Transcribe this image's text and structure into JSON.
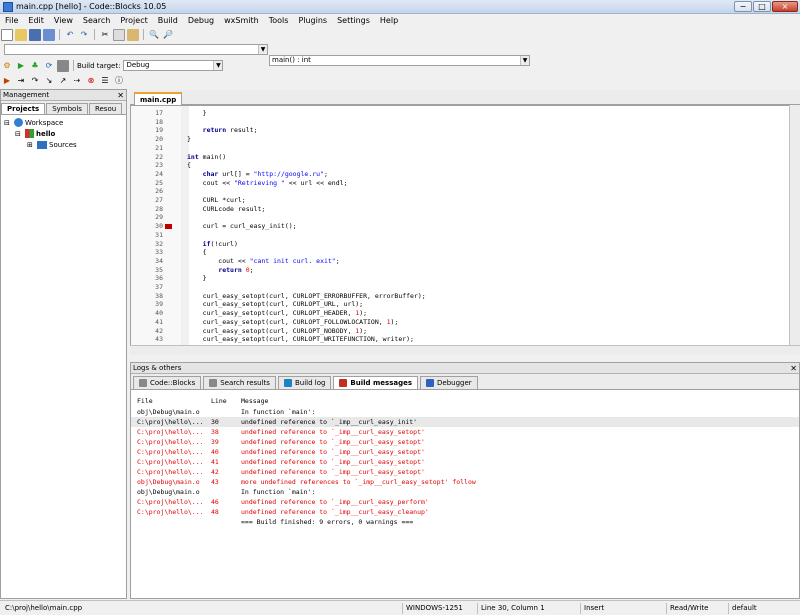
{
  "window": {
    "title": "main.cpp [hello] - Code::Blocks 10.05",
    "min": "−",
    "max": "□",
    "close": "×"
  },
  "menu": [
    "File",
    "Edit",
    "View",
    "Search",
    "Project",
    "Build",
    "Debug",
    "wxSmith",
    "Tools",
    "Plugins",
    "Settings",
    "Help"
  ],
  "toolbar": {
    "function_combo": "main() : int",
    "build_target_label": "Build target:",
    "build_target_value": "Debug"
  },
  "management": {
    "title": "Management",
    "tabs": [
      "Projects",
      "Symbols",
      "Resou"
    ],
    "tree": {
      "workspace": "Workspace",
      "project": "hello",
      "folder": "Sources"
    }
  },
  "editor": {
    "tab": "main.cpp",
    "lines": [
      {
        "n": "17",
        "t": "    }"
      },
      {
        "n": "18",
        "t": ""
      },
      {
        "n": "19",
        "t": "    return result;"
      },
      {
        "n": "20",
        "t": "}"
      },
      {
        "n": "21",
        "t": ""
      },
      {
        "n": "22",
        "t": "int main()"
      },
      {
        "n": "23",
        "t": "{"
      },
      {
        "n": "24",
        "t": "    char url[] = \"http://google.ru\";"
      },
      {
        "n": "25",
        "t": "    cout << \"Retrieving \" << url << endl;"
      },
      {
        "n": "26",
        "t": ""
      },
      {
        "n": "27",
        "t": "    CURL *curl;"
      },
      {
        "n": "28",
        "t": "    CURLcode result;"
      },
      {
        "n": "29",
        "t": ""
      },
      {
        "n": "30",
        "t": "    curl = curl_easy_init();"
      },
      {
        "n": "31",
        "t": ""
      },
      {
        "n": "32",
        "t": "    if(!curl)"
      },
      {
        "n": "33",
        "t": "    {"
      },
      {
        "n": "34",
        "t": "        cout << \"cant init curl. exit\";"
      },
      {
        "n": "35",
        "t": "        return 0;"
      },
      {
        "n": "36",
        "t": "    }"
      },
      {
        "n": "37",
        "t": ""
      },
      {
        "n": "38",
        "t": "    curl_easy_setopt(curl, CURLOPT_ERRORBUFFER, errorBuffer);"
      },
      {
        "n": "39",
        "t": "    curl_easy_setopt(curl, CURLOPT_URL, url);"
      },
      {
        "n": "40",
        "t": "    curl_easy_setopt(curl, CURLOPT_HEADER, 1);"
      },
      {
        "n": "41",
        "t": "    curl_easy_setopt(curl, CURLOPT_FOLLOWLOCATION, 1);"
      },
      {
        "n": "42",
        "t": "    curl_easy_setopt(curl, CURLOPT_NOBODY, 1);"
      },
      {
        "n": "43",
        "t": "    curl_easy_setopt(curl, CURLOPT_WRITEFUNCTION, writer);"
      }
    ]
  },
  "logs": {
    "title": "Logs & others",
    "tabs": [
      "Code::Blocks",
      "Search results",
      "Build log",
      "Build messages",
      "Debugger"
    ],
    "headers": [
      "File",
      "Line",
      "Message"
    ],
    "rows": [
      {
        "f": "obj\\Debug\\main.o",
        "l": "",
        "m": "In function `main':",
        "red": false
      },
      {
        "f": "C:\\proj\\hello\\...",
        "l": "30",
        "m": "undefined reference to `_imp__curl_easy_init'",
        "red": false,
        "sel": true
      },
      {
        "f": "C:\\proj\\hello\\...",
        "l": "38",
        "m": "undefined reference to `_imp__curl_easy_setopt'",
        "red": true
      },
      {
        "f": "C:\\proj\\hello\\...",
        "l": "39",
        "m": "undefined reference to `_imp__curl_easy_setopt'",
        "red": true
      },
      {
        "f": "C:\\proj\\hello\\...",
        "l": "40",
        "m": "undefined reference to `_imp__curl_easy_setopt'",
        "red": true
      },
      {
        "f": "C:\\proj\\hello\\...",
        "l": "41",
        "m": "undefined reference to `_imp__curl_easy_setopt'",
        "red": true
      },
      {
        "f": "C:\\proj\\hello\\...",
        "l": "42",
        "m": "undefined reference to `_imp__curl_easy_setopt'",
        "red": true
      },
      {
        "f": "obj\\Debug\\main.o",
        "l": "43",
        "m": "more undefined references to `_imp__curl_easy_setopt' follow",
        "red": true
      },
      {
        "f": "obj\\Debug\\main.o",
        "l": "",
        "m": "In function `main':",
        "red": false
      },
      {
        "f": "C:\\proj\\hello\\...",
        "l": "46",
        "m": "undefined reference to `_imp__curl_easy_perform'",
        "red": true
      },
      {
        "f": "C:\\proj\\hello\\...",
        "l": "48",
        "m": "undefined reference to `_imp__curl_easy_cleanup'",
        "red": true
      },
      {
        "f": "",
        "l": "",
        "m": "=== Build finished: 9 errors, 0 warnings ===",
        "red": false
      }
    ]
  },
  "status": {
    "path": "C:\\proj\\hello\\main.cpp",
    "encoding": "WINDOWS-1251",
    "position": "Line 30, Column 1",
    "mode": "Insert",
    "access": "Read/Write",
    "profile": "default"
  }
}
